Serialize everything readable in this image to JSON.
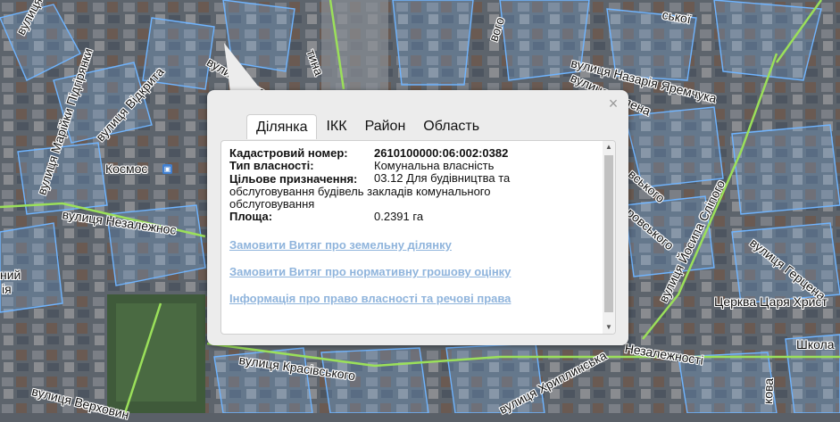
{
  "map": {
    "street_labels": [
      {
        "id": "boh",
        "text": "вулиця Бо"
      },
      {
        "id": "pidhirianky",
        "text": "вулиця Марійки Підгірянки"
      },
      {
        "id": "vidkryta",
        "text": "вулиця Відкрита"
      },
      {
        "id": "stefanyka",
        "text": "вулиця Стефаника"
      },
      {
        "id": "nezalezhnosti-left",
        "text": "вулиця Незалежнос"
      },
      {
        "id": "krasivskoho",
        "text": "вулиця Красівського"
      },
      {
        "id": "verkhovynska",
        "text": "вулиця Верховин"
      },
      {
        "id": "nazariia",
        "text": "вулиця Назарія Яремчука"
      },
      {
        "id": "zelena",
        "text": "вулиця Зелена"
      },
      {
        "id": "hertsena",
        "text": "вулиця Герцена"
      },
      {
        "id": "sipoho",
        "text": "вулиця Йосипа Сліпого"
      },
      {
        "id": "khryplynska",
        "text": "вулиця Хриплинська"
      },
      {
        "id": "nezalezhnosti-right",
        "text": "Незалежності"
      },
      {
        "id": "koi",
        "text": "ської"
      },
      {
        "id": "tyna",
        "text": "тина"
      },
      {
        "id": "voho",
        "text": "вого"
      },
      {
        "id": "vskoho",
        "text": "вського"
      },
      {
        "id": "rovskoho",
        "text": "ровського"
      },
      {
        "id": "shkola",
        "text": "Школа"
      },
      {
        "id": "kova",
        "text": "кова"
      },
      {
        "id": "ny",
        "text": "ний"
      },
      {
        "id": "ria",
        "text": "ія"
      }
    ],
    "poi": {
      "name": "Космос",
      "badge": "▣"
    },
    "church": {
      "name": "Церква Царя Христ"
    }
  },
  "popup": {
    "close_label": "×",
    "tabs": [
      {
        "label": "Ділянка",
        "active": true
      },
      {
        "label": "ІКК",
        "active": false
      },
      {
        "label": "Район",
        "active": false
      },
      {
        "label": "Область",
        "active": false
      }
    ],
    "fields": [
      {
        "key": "Кадастровий номер:",
        "value": "2610100000:06:002:0382",
        "bold": true
      },
      {
        "key": "Тип власності:",
        "value": "Комунальна власність",
        "bold": false
      },
      {
        "key": "Цільове призначення:",
        "value": "03.12 Для будівництва та обслуговування будівель закладів комунального обслуговування",
        "bold": false
      },
      {
        "key": "Площа:",
        "value": "0.2391 га",
        "bold": false
      }
    ],
    "links": [
      "Замовити Витяг про земельну ділянку",
      "Замовити Витяг про нормативну грошову оцінку",
      "Інформація про право власності та речові права"
    ],
    "scroll_up": "▲",
    "scroll_down": "▼"
  },
  "colors": {
    "parcel_outline": "#6fb4ff",
    "road_green": "#9be05a",
    "link": "#8fb4dc"
  }
}
